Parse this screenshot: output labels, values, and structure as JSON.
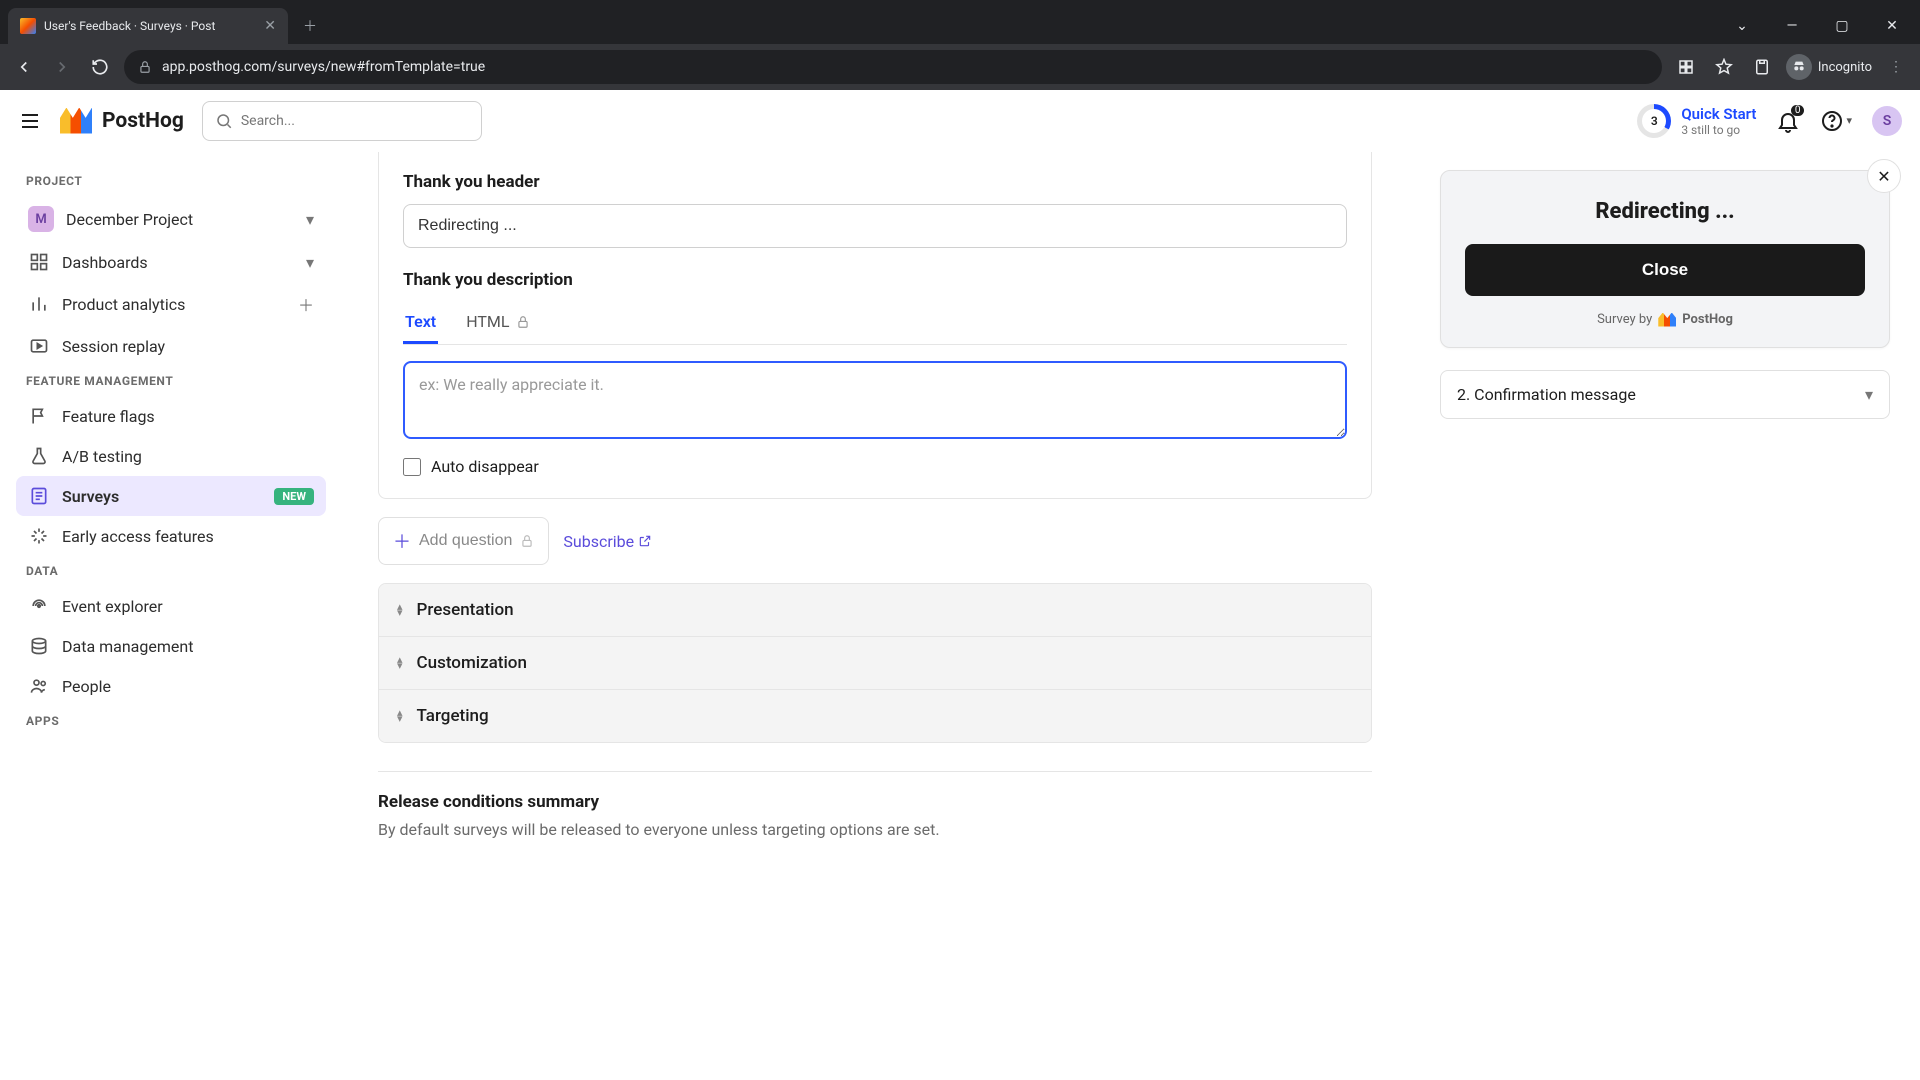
{
  "browser": {
    "tab_title": "User's Feedback · Surveys · Post",
    "url": "app.posthog.com/surveys/new#fromTemplate=true",
    "incognito_label": "Incognito"
  },
  "header": {
    "search_placeholder": "Search...",
    "quick_start": {
      "title": "Quick Start",
      "subtitle": "3 still to go",
      "progress_count": "3"
    },
    "notifications_count": "0",
    "avatar_letter": "S"
  },
  "sidebar": {
    "sections": {
      "project": "PROJECT",
      "feature": "FEATURE MANAGEMENT",
      "data": "DATA",
      "apps": "APPS"
    },
    "project_name": "December Project",
    "project_badge": "M",
    "items": {
      "dashboards": "Dashboards",
      "product_analytics": "Product analytics",
      "session_replay": "Session replay",
      "feature_flags": "Feature flags",
      "ab_testing": "A/B testing",
      "surveys": "Surveys",
      "surveys_badge": "NEW",
      "early_access": "Early access features",
      "event_explorer": "Event explorer",
      "data_management": "Data management",
      "people": "People"
    }
  },
  "main": {
    "thank_you_header_label": "Thank you header",
    "thank_you_header_value": "Redirecting ...",
    "thank_you_desc_label": "Thank you description",
    "desc_tabs": {
      "text": "Text",
      "html": "HTML"
    },
    "desc_placeholder": "ex: We really appreciate it.",
    "auto_disappear_label": "Auto disappear",
    "add_question": "Add question",
    "subscribe": "Subscribe",
    "accordions": {
      "presentation": "Presentation",
      "customization": "Customization",
      "targeting": "Targeting"
    },
    "release_title": "Release conditions summary",
    "release_desc": "By default surveys will be released to everyone unless targeting options are set."
  },
  "preview": {
    "title": "Redirecting ...",
    "close_btn": "Close",
    "survey_by": "Survey by",
    "brand": "PostHog",
    "step_select": "2. Confirmation message"
  }
}
